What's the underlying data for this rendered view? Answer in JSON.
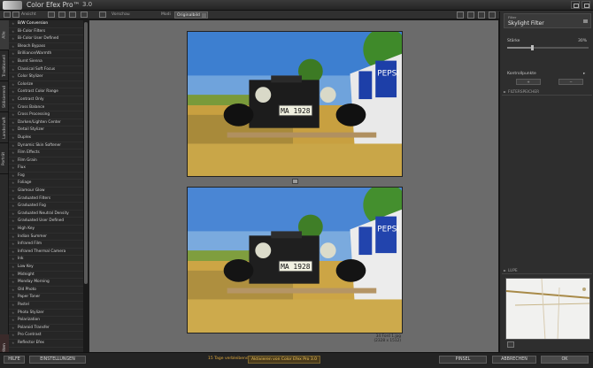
{
  "app": {
    "title": "Color Efex Pro™",
    "version": "3.0"
  },
  "toolbar": {
    "view_label": "Ansicht",
    "zoom_label": "Vorschau",
    "mode_label": "Modi",
    "view_selected": "Originalbild"
  },
  "tabs": [
    "Alle",
    "Traditionell",
    "Stilisierend",
    "Landschaft",
    "Porträt"
  ],
  "favorites_tab": "Favoriten",
  "filters": [
    "B/W Conversion",
    "Bi-Color Filters",
    "Bi-Color User Defined",
    "Bleach Bypass",
    "Brilliance/Warmth",
    "Burnt Sienna",
    "Classical Soft Focus",
    "Color Stylizer",
    "Colorize",
    "Contrast Color Range",
    "Contrast Only",
    "Cross Balance",
    "Cross Processing",
    "Darken/Lighten Center",
    "Detail Stylizer",
    "Duplex",
    "Dynamic Skin Softener",
    "Film Effects",
    "Film Grain",
    "Flux",
    "Fog",
    "Foliage",
    "Glamour Glow",
    "Graduated Filters",
    "Graduated Fog",
    "Graduated Neutral Density",
    "Graduated User Defined",
    "High Key",
    "Indian Summer",
    "Infrared Film",
    "Infrared Thermal Camera",
    "Ink",
    "Low Key",
    "Midnight",
    "Monday Morning",
    "Old Photo",
    "Paper Toner",
    "Pastel",
    "Photo Stylizer",
    "Polarization",
    "Polaroid Transfer",
    "Pro Contrast",
    "Reflector Efex"
  ],
  "preview": {
    "caption_line1": "34 Ford 1.jpg",
    "caption_line2": "(2328 x 1512)",
    "plate_text": "MA 1928",
    "sign_text": "PEPSI"
  },
  "right_panel": {
    "filter_header_label": "Filter",
    "filter_name": "Skylight Filter",
    "strength_label": "Stärke",
    "strength_value": "30%",
    "strength_fraction": 0.3,
    "control_points_label": "Kontrollpunkte",
    "btn_add": "+",
    "btn_remove": "−",
    "section_filter_memory": "FILTERSPEICHER",
    "section_loupe": "LUPE"
  },
  "bottom": {
    "help": "HILFE",
    "settings": "EINSTELLUNGEN",
    "trial": "15 Tage verbleibend",
    "activate": "Aktivieren von Color Efex Pro 3.0",
    "brush": "PINSEL",
    "cancel": "ABBRECHEN",
    "ok": "OK"
  },
  "colors": {
    "accent_orange": "#e0a93b",
    "favorites_red": "#c0392b",
    "panel_bg": "#2e2e2e",
    "preview_bg": "#6b6b6b"
  }
}
